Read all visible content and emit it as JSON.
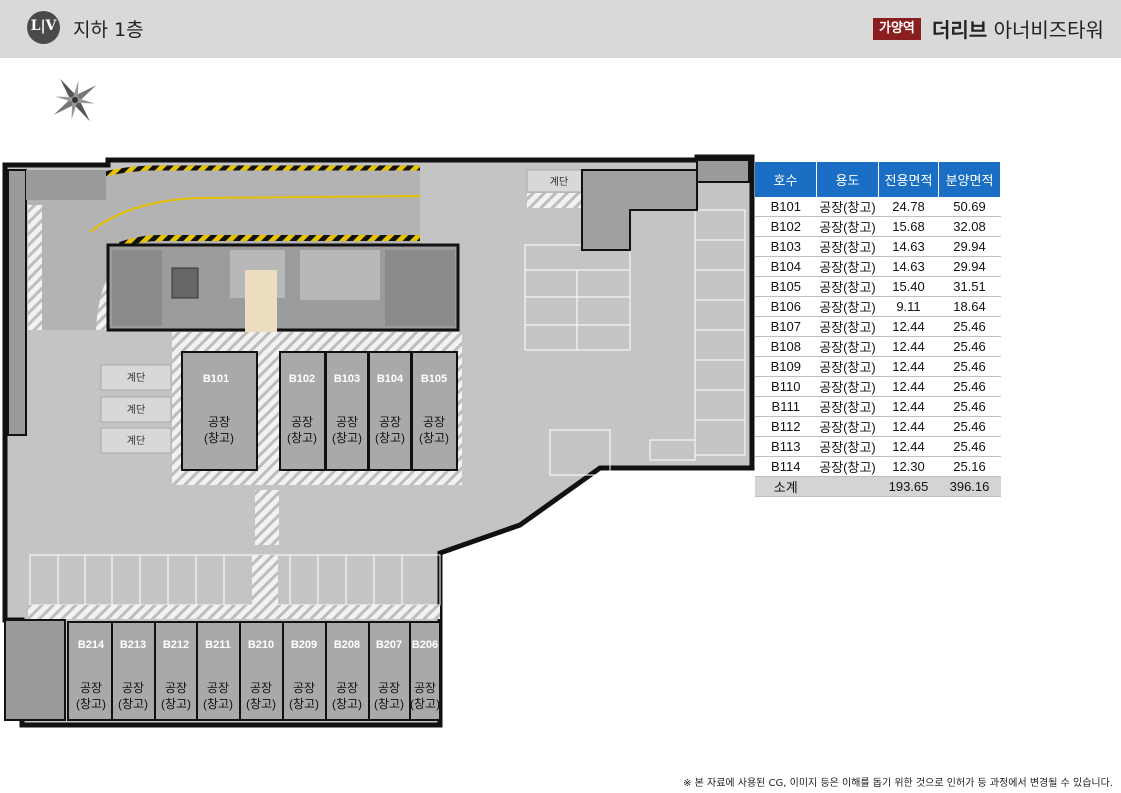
{
  "header": {
    "logo_text": "L|V",
    "floor_title": "지하 1층",
    "area_badge": "가양역",
    "brand_bold": "더리브",
    "brand_rest": "아너비즈타워"
  },
  "compass": {
    "icon": "compass-rose-icon"
  },
  "floorplan": {
    "stair_label": "계단",
    "units_top": [
      {
        "id": "B101",
        "line1": "공장",
        "line2": "(창고)"
      },
      {
        "id": "B102",
        "line1": "공장",
        "line2": "(창고)"
      },
      {
        "id": "B103",
        "line1": "공장",
        "line2": "(창고)"
      },
      {
        "id": "B104",
        "line1": "공장",
        "line2": "(창고)"
      },
      {
        "id": "B105",
        "line1": "공장",
        "line2": "(창고)"
      }
    ],
    "units_bottom": [
      {
        "id": "B214",
        "line1": "공장",
        "line2": "(창고)"
      },
      {
        "id": "B213",
        "line1": "공장",
        "line2": "(창고)"
      },
      {
        "id": "B212",
        "line1": "공장",
        "line2": "(창고)"
      },
      {
        "id": "B211",
        "line1": "공장",
        "line2": "(창고)"
      },
      {
        "id": "B210",
        "line1": "공장",
        "line2": "(창고)"
      },
      {
        "id": "B209",
        "line1": "공장",
        "line2": "(창고)"
      },
      {
        "id": "B208",
        "line1": "공장",
        "line2": "(창고)"
      },
      {
        "id": "B207",
        "line1": "공장",
        "line2": "(창고)"
      },
      {
        "id": "B206",
        "line1": "공장",
        "line2": "(창고)"
      }
    ]
  },
  "table": {
    "headers": [
      "호수",
      "용도",
      "전용면적",
      "분양면적"
    ],
    "rows": [
      [
        "B101",
        "공장(창고)",
        "24.78",
        "50.69"
      ],
      [
        "B102",
        "공장(창고)",
        "15.68",
        "32.08"
      ],
      [
        "B103",
        "공장(창고)",
        "14.63",
        "29.94"
      ],
      [
        "B104",
        "공장(창고)",
        "14.63",
        "29.94"
      ],
      [
        "B105",
        "공장(창고)",
        "15.40",
        "31.51"
      ],
      [
        "B106",
        "공장(창고)",
        "9.11",
        "18.64"
      ],
      [
        "B107",
        "공장(창고)",
        "12.44",
        "25.46"
      ],
      [
        "B108",
        "공장(창고)",
        "12.44",
        "25.46"
      ],
      [
        "B109",
        "공장(창고)",
        "12.44",
        "25.46"
      ],
      [
        "B110",
        "공장(창고)",
        "12.44",
        "25.46"
      ],
      [
        "B111",
        "공장(창고)",
        "12.44",
        "25.46"
      ],
      [
        "B112",
        "공장(창고)",
        "12.44",
        "25.46"
      ],
      [
        "B113",
        "공장(창고)",
        "12.44",
        "25.46"
      ],
      [
        "B114",
        "공장(창고)",
        "12.30",
        "25.16"
      ]
    ],
    "total": [
      "소계",
      "",
      "193.65",
      "396.16"
    ]
  },
  "disclaimer": "※ 본 자료에 사용된 CG, 이미지 등은 이해를 돕기 위한 것으로 인허가 등 과정에서 변경될 수 있습니다.",
  "colors": {
    "header_bg": "#d9d9d9",
    "badge": "#8b1e1e",
    "table_header": "#1a6fc4",
    "floor": "#c4c4c4",
    "wall": "#111111",
    "unit": "#a9a9a9",
    "corridor": "#ecdcc0"
  }
}
